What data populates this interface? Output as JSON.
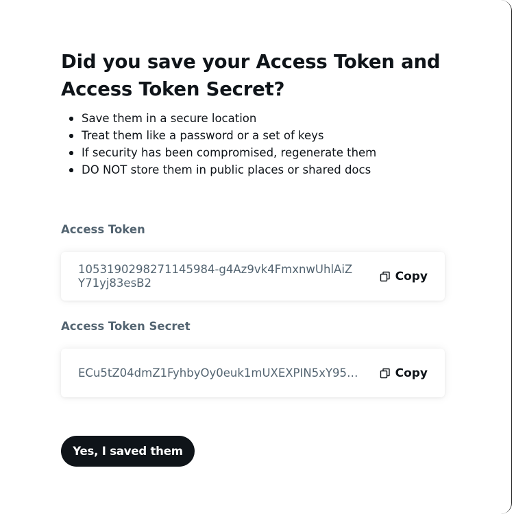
{
  "dialog": {
    "title": "Did you save your Access Token and Access Token Secret?",
    "tips": [
      "Save them in a secure location",
      "Treat them like a password or a set of keys",
      "If security has been compromised, regenerate them",
      "DO NOT store them in public places or shared docs"
    ]
  },
  "access_token": {
    "label": "Access Token",
    "value": "1053190298271145984-g4Az9vk4FmxnwUhlAiZY71yj83esB2",
    "copy_label": "Copy",
    "copy_icon": "copy-icon"
  },
  "access_token_secret": {
    "label": "Access Token Secret",
    "value": "ECu5tZ04dmZ1FyhbyOy0euk1mUXEXPIN5xY95B...",
    "copy_label": "Copy",
    "copy_icon": "copy-icon"
  },
  "confirm_button": {
    "label": "Yes, I saved them"
  },
  "colors": {
    "text_primary": "#0f1419",
    "text_secondary": "#536471",
    "button_background": "#0f1419",
    "button_text": "#ffffff"
  }
}
